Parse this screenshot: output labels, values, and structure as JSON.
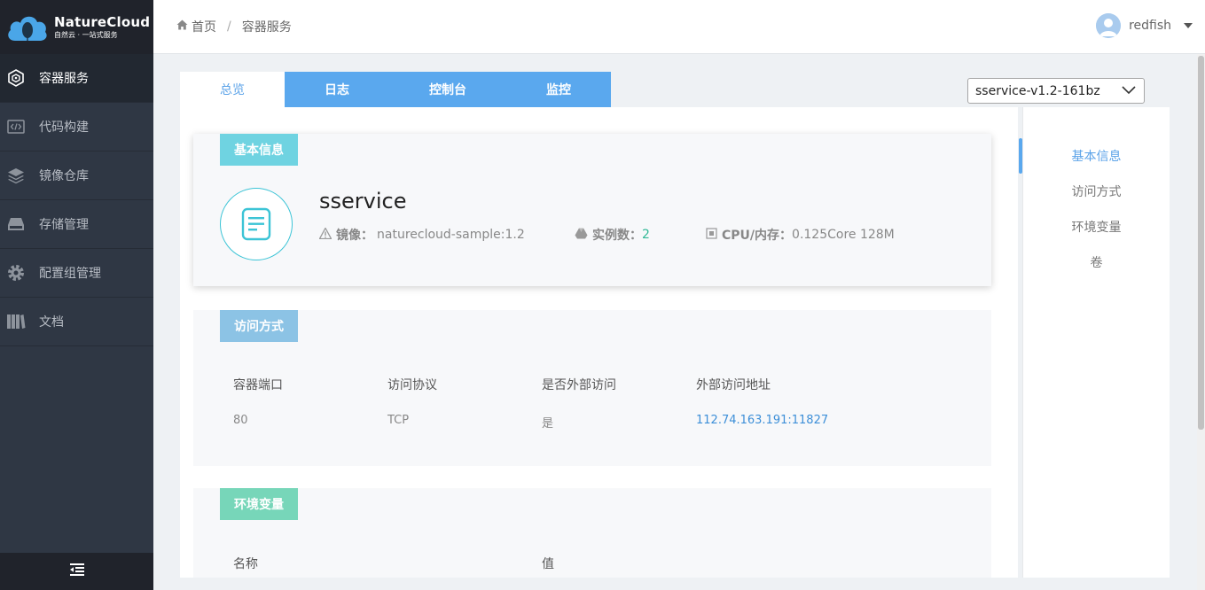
{
  "app": {
    "logo_title": "NatureCloud",
    "logo_subtitle": "自然云 · 一站式服务"
  },
  "sidebar": {
    "items": [
      {
        "label": "容器服务",
        "icon": "cube-icon",
        "active": true
      },
      {
        "label": "代码构建",
        "icon": "code-icon",
        "active": false
      },
      {
        "label": "镜像仓库",
        "icon": "layers-icon",
        "active": false
      },
      {
        "label": "存储管理",
        "icon": "storage-icon",
        "active": false
      },
      {
        "label": "配置组管理",
        "icon": "gear-icon",
        "active": false
      },
      {
        "label": "文档",
        "icon": "books-icon",
        "active": false
      }
    ],
    "collapse_icon": "collapse-menu-icon"
  },
  "header": {
    "breadcrumb": [
      "首页",
      "容器服务"
    ],
    "home_icon": "home-icon",
    "username": "redfish"
  },
  "tabs": [
    "总览",
    "日志",
    "控制台",
    "监控"
  ],
  "version_select": {
    "value": "sservice-v1.2-161bz"
  },
  "basic_info": {
    "tag": "基本信息",
    "service_name": "sservice",
    "image_label": "镜像：",
    "image_value": "naturecloud-sample:1.2",
    "instances_label": "实例数：",
    "instances_value": "2",
    "cpu_label": "CPU/内存：",
    "cpu_value": "0.125Core 128M"
  },
  "access": {
    "tag": "访问方式",
    "headers": [
      "容器端口",
      "访问协议",
      "是否外部访问",
      "外部访问地址"
    ],
    "rows": [
      [
        "80",
        "TCP",
        "是",
        "112.74.163.191:11827"
      ]
    ]
  },
  "env": {
    "tag": "环境变量",
    "headers": [
      "名称",
      "值"
    ]
  },
  "anchors": [
    "基本信息",
    "访问方式",
    "环境变量",
    "卷"
  ],
  "colors": {
    "sidebar_bg": "#2f3744",
    "accent_blue": "#5aa8ee",
    "tag_cyan": "#6fd3e1",
    "tag_blue": "#8cc3e5",
    "tag_green": "#77d6b9",
    "instance_green": "#31b896"
  }
}
